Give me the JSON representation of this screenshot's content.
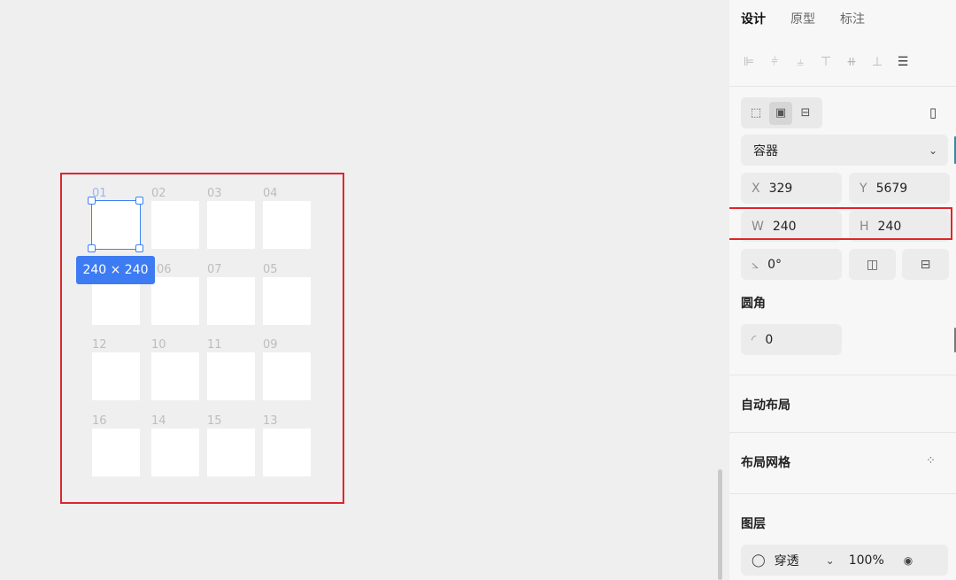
{
  "canvas": {
    "selection_size": "240 × 240",
    "frames": [
      {
        "label": "01",
        "selected": true
      },
      {
        "label": "02"
      },
      {
        "label": "03"
      },
      {
        "label": "04"
      },
      {
        "label": "06"
      },
      {
        "label": "07"
      },
      {
        "label": "05"
      },
      {
        "label": "12"
      },
      {
        "label": "10"
      },
      {
        "label": "11"
      },
      {
        "label": "09"
      },
      {
        "label": "16"
      },
      {
        "label": "14"
      },
      {
        "label": "15"
      },
      {
        "label": "13"
      }
    ]
  },
  "panel": {
    "tabs": [
      "设计",
      "原型",
      "标注"
    ],
    "active_tab": "设计",
    "container_type": "容器",
    "x_label": "X",
    "x_value": "329",
    "y_label": "Y",
    "y_value": "5679",
    "w_label": "W",
    "w_value": "240",
    "h_label": "H",
    "h_value": "240",
    "rotation_value": "0°",
    "corner_radius_title": "圆角",
    "corner_radius_value": "0",
    "auto_layout_title": "自动布局",
    "layout_grid_title": "布局网格",
    "layers_title": "图层",
    "blend_mode": "穿透",
    "opacity": "100%"
  },
  "colors": {
    "accent": "#3d7bf2",
    "highlight": "#e0242c",
    "canvas_bg": "#efefef",
    "panel_bg": "#f7f7f7"
  }
}
